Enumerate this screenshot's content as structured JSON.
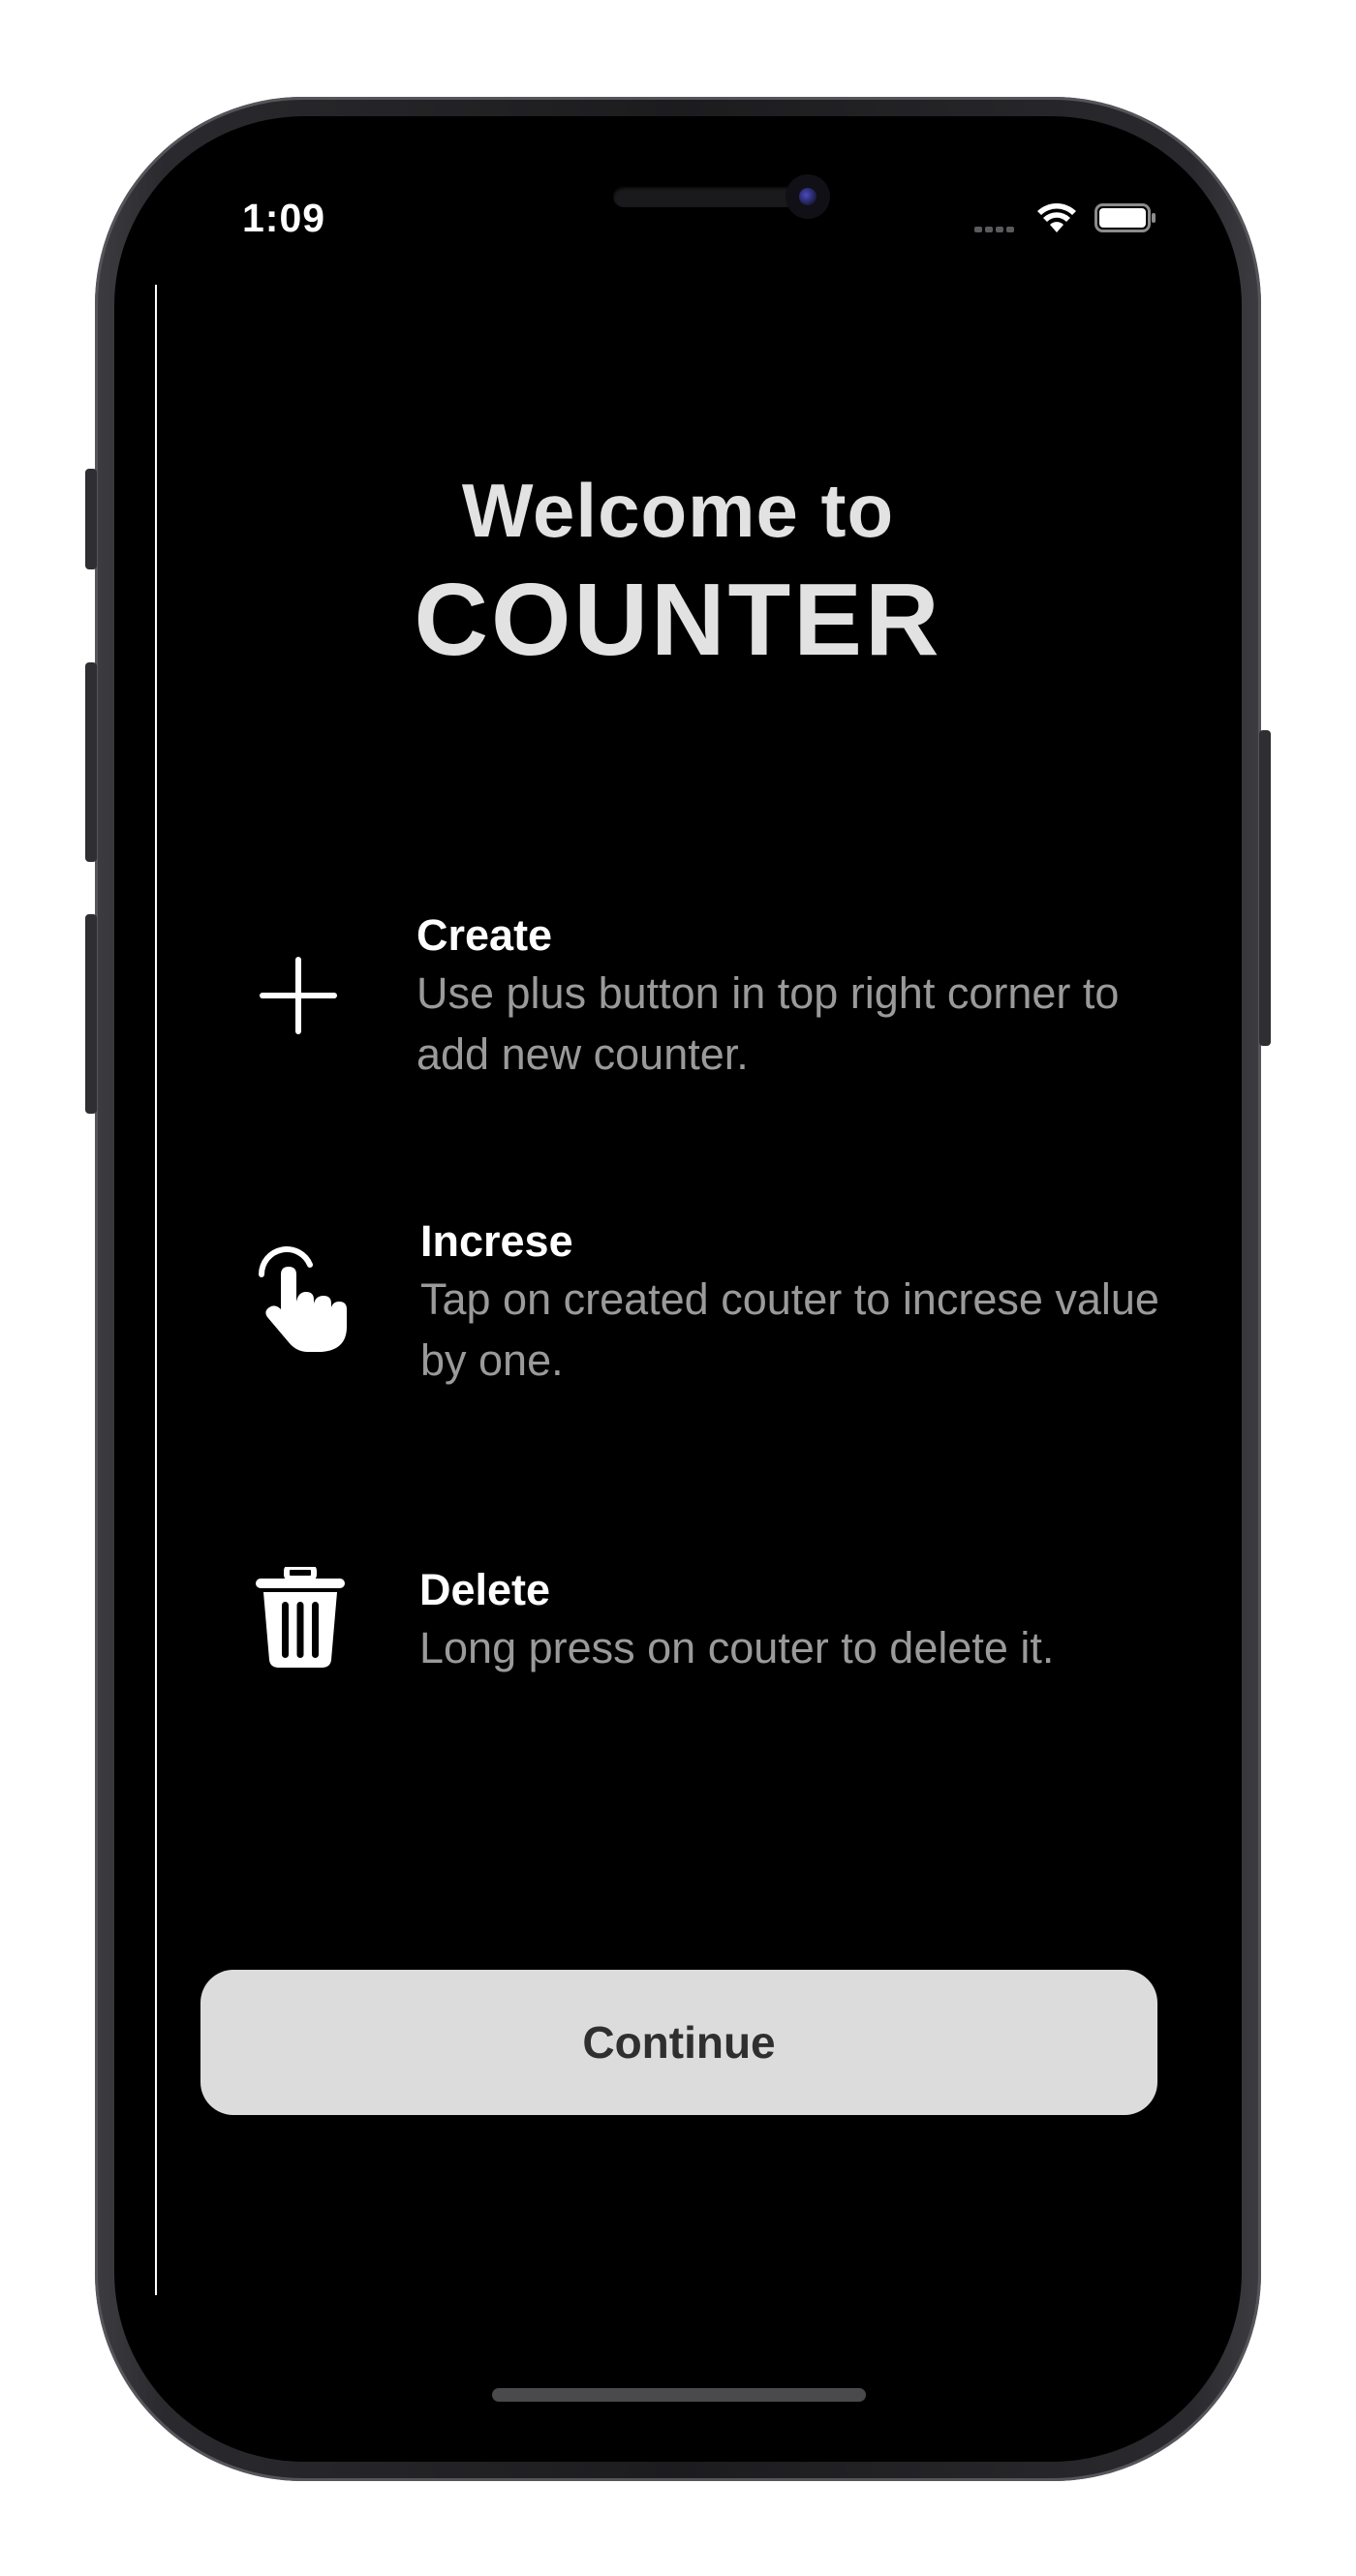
{
  "status_bar": {
    "time": "1:09"
  },
  "welcome": {
    "line1": "Welcome to",
    "line2": "COUNTER"
  },
  "features": [
    {
      "title": "Create",
      "description": "Use plus button in top right corner to add new counter.",
      "icon": "plus-icon"
    },
    {
      "title": "Increse",
      "description": "Tap on created couter to increse value by one.",
      "icon": "hand-tap-icon"
    },
    {
      "title": "Delete",
      "description": "Long press on couter to delete it.",
      "icon": "trash-icon"
    }
  ],
  "continue_button": {
    "label": "Continue"
  },
  "colors": {
    "background": "#000000",
    "title_text": "#e2e2e2",
    "feature_title": "#ffffff",
    "feature_description": "#9a9a9a",
    "button_background": "#dcdcdc",
    "button_text": "#2f2f2f"
  }
}
